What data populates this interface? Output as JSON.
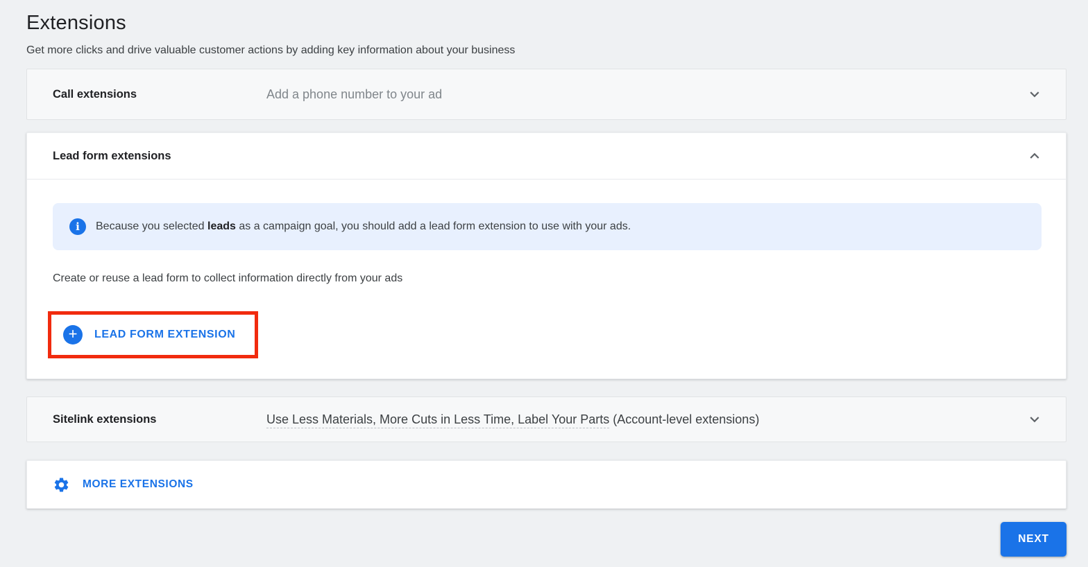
{
  "page": {
    "title": "Extensions",
    "subtitle": "Get more clicks and drive valuable customer actions by adding key information about your business"
  },
  "panels": {
    "call": {
      "label": "Call extensions",
      "value": "Add a phone number to your ad",
      "chevron_icon": "chevron-down"
    },
    "lead_form": {
      "label": "Lead form extensions",
      "chevron_icon": "chevron-up",
      "banner": {
        "icon": "info-circle",
        "text_before": "Because you selected ",
        "text_bold": "leads",
        "text_after": " as a campaign goal, you should add a lead form extension to use with your ads."
      },
      "description": "Create or reuse a lead form to collect information directly from your ads",
      "button_icon": "plus-circle",
      "button_label": "LEAD FORM EXTENSION"
    },
    "sitelink": {
      "label": "Sitelink extensions",
      "value_underlined": "Use Less Materials, More Cuts in Less Time, Label Your Parts",
      "value_suffix": " (Account-level extensions)",
      "chevron_icon": "chevron-down"
    },
    "more": {
      "icon": "gear",
      "label": "MORE EXTENSIONS"
    }
  },
  "footer": {
    "next_label": "NEXT"
  },
  "annotation": {
    "type": "red-highlight-rectangle",
    "target": "lead-form-extension-button"
  },
  "colors": {
    "accent_blue": "#1a73e8",
    "banner_bg": "#e8f0fe",
    "annotation_red": "#f12b0e",
    "page_bg": "#eff1f3"
  }
}
